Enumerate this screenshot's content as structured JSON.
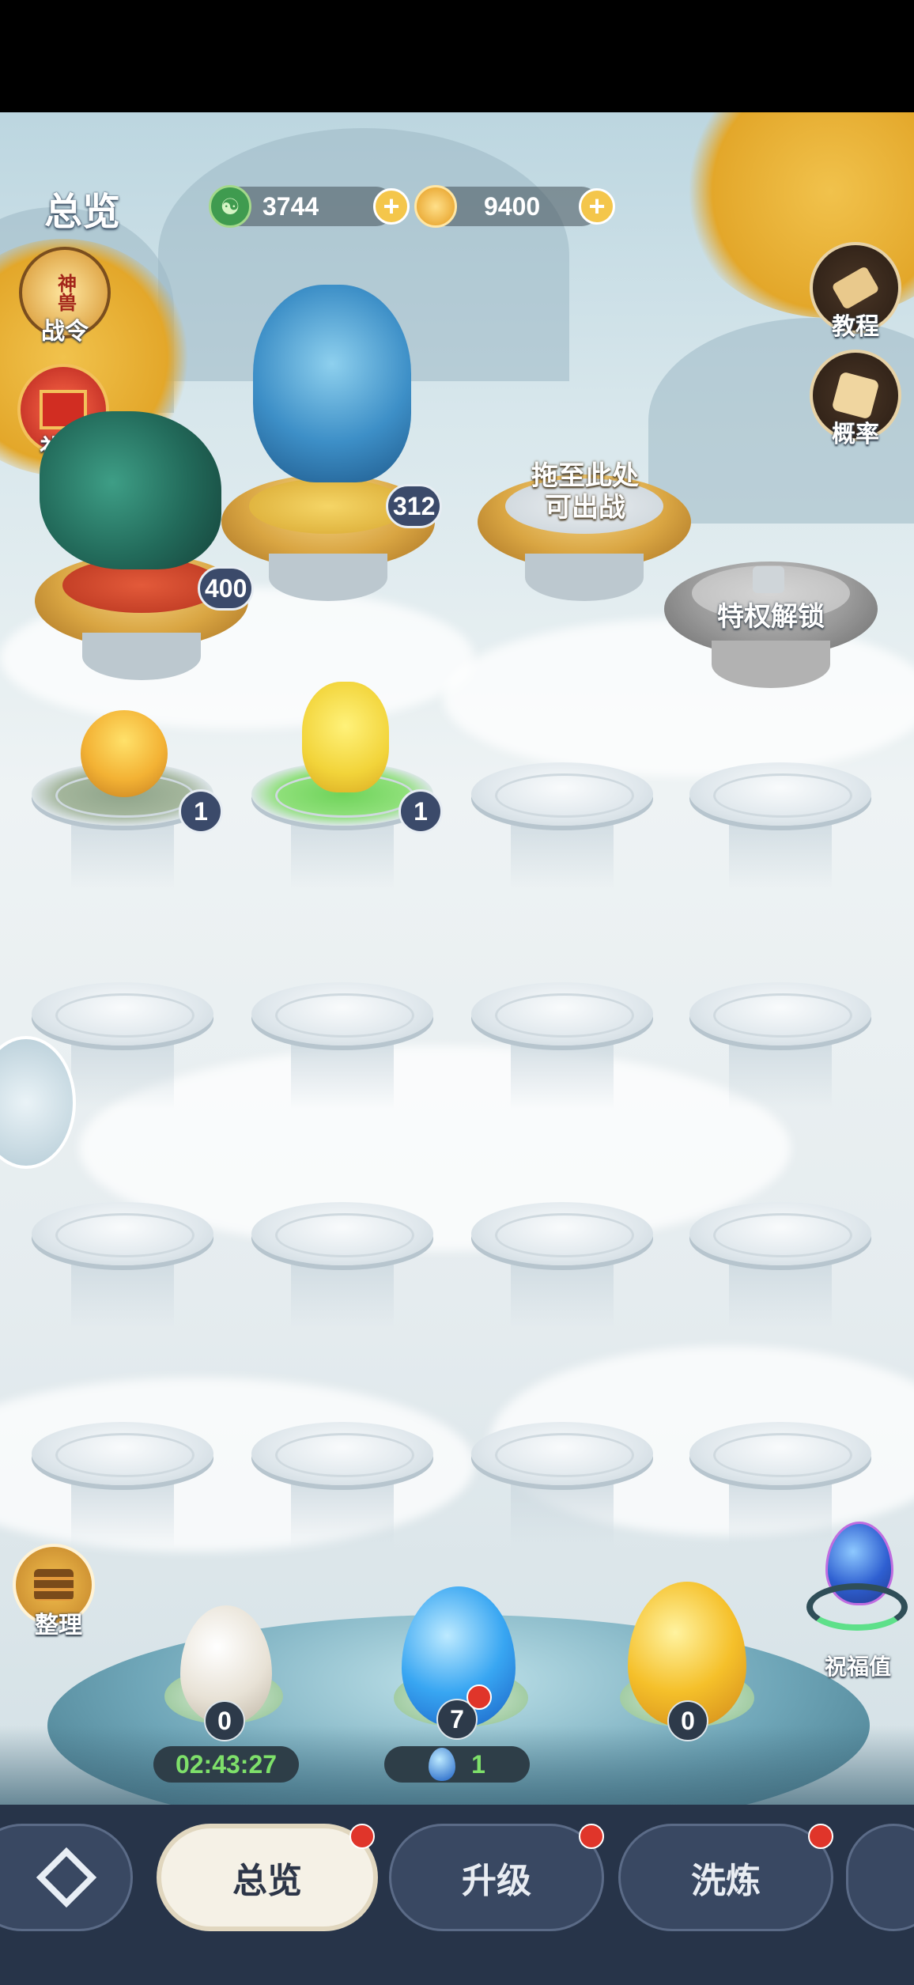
{
  "header": {
    "title": "总览",
    "jade": {
      "value": "3744",
      "icon": "jade-coin-icon"
    },
    "gold": {
      "value": "9400",
      "icon": "gold-coin-icon"
    }
  },
  "side_left": {
    "battle_pass": {
      "label": "战令",
      "emblem": "神兽"
    },
    "gift": {
      "label": "礼包"
    }
  },
  "side_right": {
    "tutorial": {
      "label": "教程"
    },
    "probability": {
      "label": "概率"
    }
  },
  "battle_slots": [
    {
      "occupied": true,
      "pet": "green-dragon",
      "power": "400"
    },
    {
      "occupied": true,
      "pet": "blue-qilin",
      "power": "312"
    },
    {
      "occupied": false,
      "hint": "拖至此处可出战",
      "hint_line1": "拖至此处",
      "hint_line2": "可出战"
    },
    {
      "locked": true,
      "hint": "特权解锁"
    }
  ],
  "pets": [
    {
      "name": "chick-in-egg",
      "level": "1"
    },
    {
      "name": "yellow-chick",
      "level": "1"
    }
  ],
  "tidy": {
    "label": "整理"
  },
  "blessing": {
    "label": "祝福值"
  },
  "eggs": [
    {
      "kind": "white",
      "count": "0",
      "timer": "02:43:27"
    },
    {
      "kind": "blue",
      "count": "7",
      "cost": "1"
    },
    {
      "kind": "gold",
      "count": "0"
    }
  ],
  "tabs": [
    {
      "label": "总览",
      "active": true
    },
    {
      "label": "升级"
    },
    {
      "label": "洗炼"
    }
  ],
  "colors": {
    "nav_bg": "#273449",
    "tab_active": "#f5f1e6",
    "tab_inactive": "#394862",
    "badge_bg": "#3b4a6a",
    "timer_green": "#7ee06a",
    "gold": "#f4c64b"
  }
}
